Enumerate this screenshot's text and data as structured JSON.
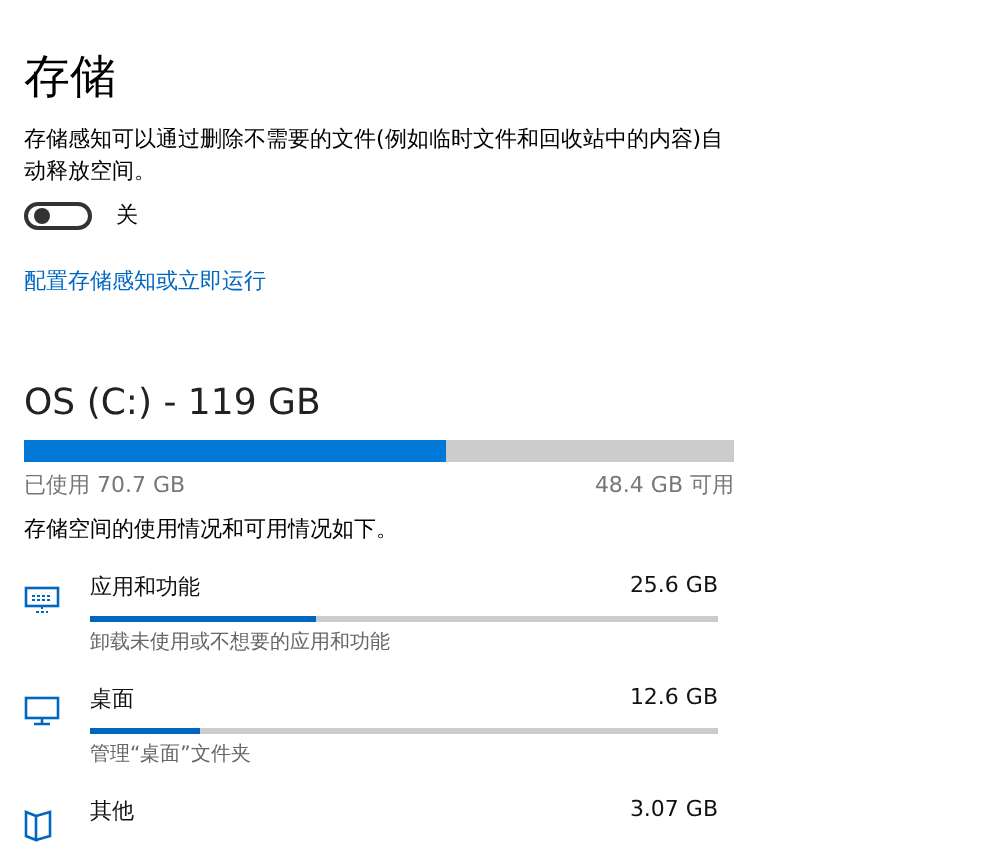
{
  "title": "存储",
  "description": "存储感知可以通过删除不需要的文件(例如临时文件和回收站中的内容)自动释放空间。",
  "storage_sense": {
    "on": false,
    "label": "关"
  },
  "configure_link": "配置存储感知或立即运行",
  "drive": {
    "title": "OS (C:) - 119 GB",
    "level": 0.594,
    "used": "已使用 70.7 GB",
    "free": "48.4 GB 可用"
  },
  "summary": "存储空间的使用情况和可用情况如下。",
  "categories": [
    {
      "kind": "apps",
      "name": "应用和功能",
      "size": "25.6 GB",
      "level": 0.36,
      "description": "卸载未使用或不想要的应用和功能"
    },
    {
      "kind": "desktop",
      "name": "桌面",
      "size": "12.6 GB",
      "level": 0.175,
      "description": "管理“桌面”文件夹"
    },
    {
      "kind": "other",
      "name": "其他",
      "size": "3.07 GB"
    }
  ]
}
